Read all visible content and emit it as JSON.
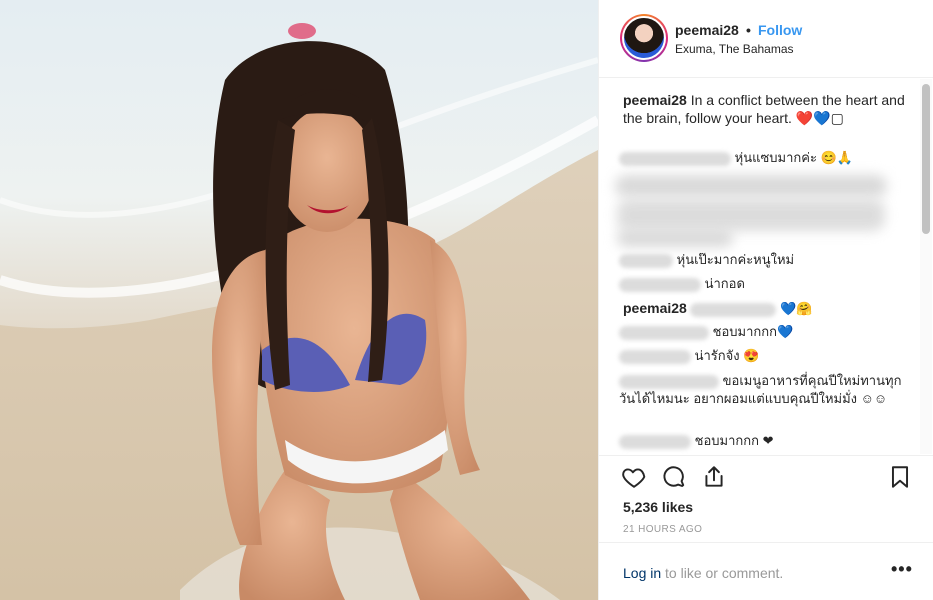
{
  "post": {
    "username": "peemai28",
    "separator": "•",
    "follow_label": "Follow",
    "location": "Exuma, The Bahamas",
    "caption_user": "peemai28",
    "caption_text": "In a conflict between the heart and the brain, follow your heart. ❤️💙▢"
  },
  "comments": [
    {
      "user": "",
      "text": "หุ่นแซบมากค่ะ 😊🙏"
    },
    {
      "user": "",
      "text": "หุ่นเป๊ะมากค่ะหนูใหม่"
    },
    {
      "user": "",
      "text": "น่ากอด"
    },
    {
      "user": "peemai28",
      "text": "💙🤗"
    },
    {
      "user": "",
      "text": "ชอบมากกก💙"
    },
    {
      "user": "",
      "text": "น่ารักจัง 😍"
    },
    {
      "user": "",
      "text": "ขอเมนูอาหารที่คุณปีใหม่ทานทุกวันได้ไหมนะ อยากผอมแต่แบบคุณปีใหม่มั่ง ☺☺"
    },
    {
      "user": "",
      "text": "ชอบมากกก ❤"
    }
  ],
  "stats": {
    "likes": "5,236 likes",
    "time": "21 HOURS AGO"
  },
  "footer": {
    "login_link": "Log in",
    "login_rest": " to like or comment.",
    "more": "•••"
  },
  "icons": {
    "like": "heart-icon",
    "comment": "comment-icon",
    "share": "share-icon",
    "save": "bookmark-icon",
    "more": "more-options-icon"
  },
  "colors": {
    "accent": "#3897f0",
    "link": "#003569",
    "muted": "#999999",
    "text": "#262626"
  }
}
